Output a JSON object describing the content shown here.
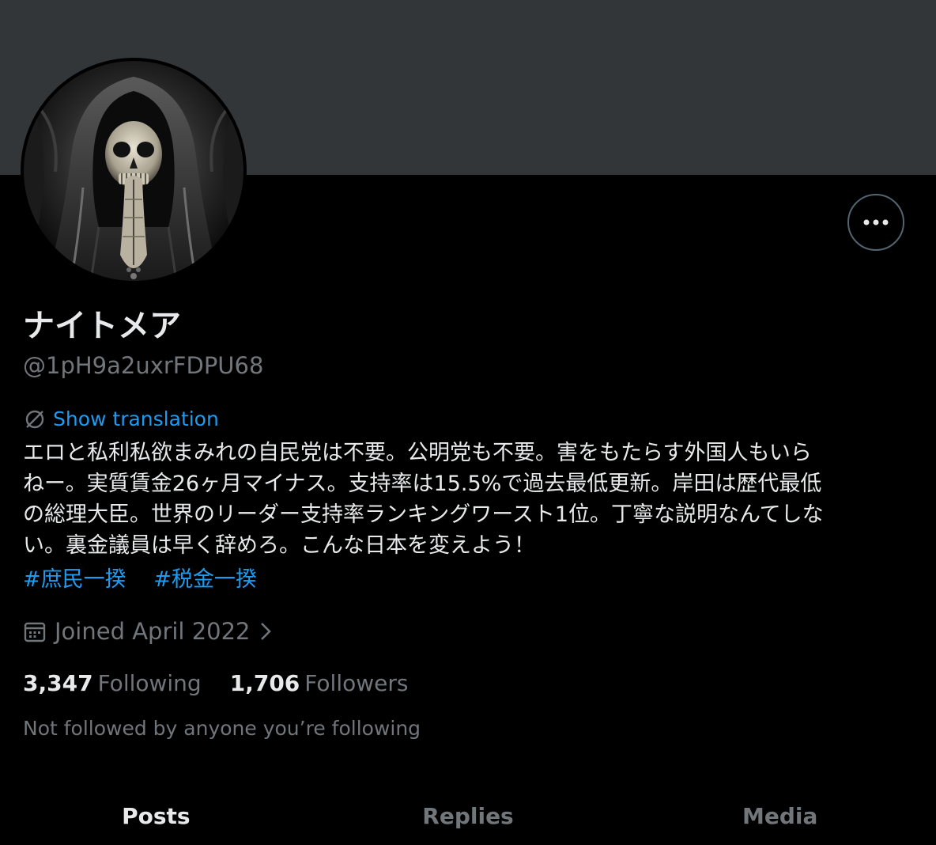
{
  "profile": {
    "display_name": "ナイトメア",
    "handle": "@1pH9a2uxrFDPU68",
    "avatar_icon": "reaper-avatar-image",
    "more_icon": "more-dots-icon"
  },
  "translation": {
    "icon": "translate-icon",
    "label": "Show translation"
  },
  "bio": {
    "lines": [
      "エロと私利私欲まみれの自民党は不要。公明党も不要。害をもたらす外国人もいら",
      "ねー。実質賃金26ヶ月マイナス。支持率は15.5%で過去最低更新。岸田は歴代最低",
      "の総理大臣。世界のリーダー支持率ランキングワースト1位。丁寧な説明なんてしな",
      "い。裏金議員は早く辞めろ。こんな日本を変えよう！"
    ],
    "hashtags": [
      "#庶民一揆",
      "#税金一揆"
    ]
  },
  "joined": {
    "icon": "calendar-icon",
    "label": "Joined April 2022",
    "chevron_icon": "chevron-right-icon"
  },
  "stats": {
    "following_count": "3,347",
    "following_label": "Following",
    "followers_count": "1,706",
    "followers_label": "Followers"
  },
  "not_followed_text": "Not followed by anyone you’re following",
  "tabs": [
    {
      "label": "Posts",
      "active": true
    },
    {
      "label": "Replies",
      "active": false
    },
    {
      "label": "Media",
      "active": false
    }
  ],
  "colors": {
    "background": "#000000",
    "banner": "#333639",
    "accent": "#1d9bf0",
    "secondary_text": "#71767b",
    "primary_text": "#e7e9ea"
  }
}
